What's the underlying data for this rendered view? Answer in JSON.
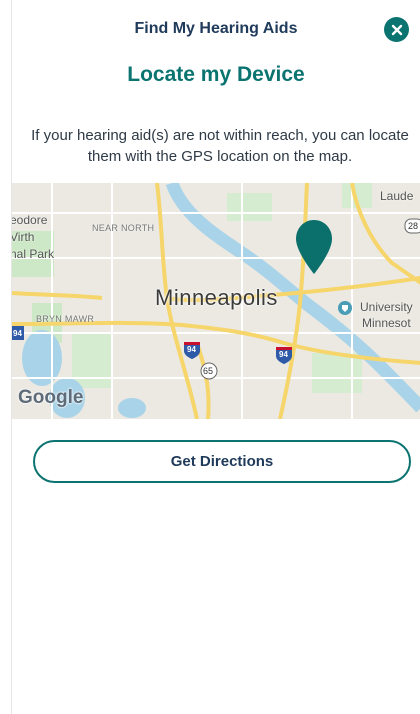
{
  "header": {
    "title": "Find My Hearing Aids",
    "close_icon": "close-icon"
  },
  "main": {
    "title": "Locate my Device",
    "description": "If your hearing aid(s) are not within reach, you can locate them with the GPS location on the map."
  },
  "map": {
    "city_label": "Minneapolis",
    "labels": {
      "theodore": "eodore",
      "wirth": "Virth",
      "park": "nal Park",
      "near_north": "NEAR NORTH",
      "bryn_mawr": "BRYN MAWR",
      "lauderdale": "Laude",
      "university": "University",
      "minnesota": "Minnesot"
    },
    "shields": {
      "i94_a": "94",
      "i94_b": "94",
      "i94_c": "94",
      "r65": "65",
      "r28": "28"
    },
    "attribution": "Google",
    "pin_icon": "map-pin-icon",
    "colors": {
      "water": "#a9d3e8",
      "park": "#cde8c6",
      "highway": "#f6d56a",
      "pin": "#0b6f6c"
    }
  },
  "actions": {
    "directions_label": "Get Directions"
  },
  "colors": {
    "accent": "#0b7471",
    "title_text": "#1f3a5a"
  }
}
